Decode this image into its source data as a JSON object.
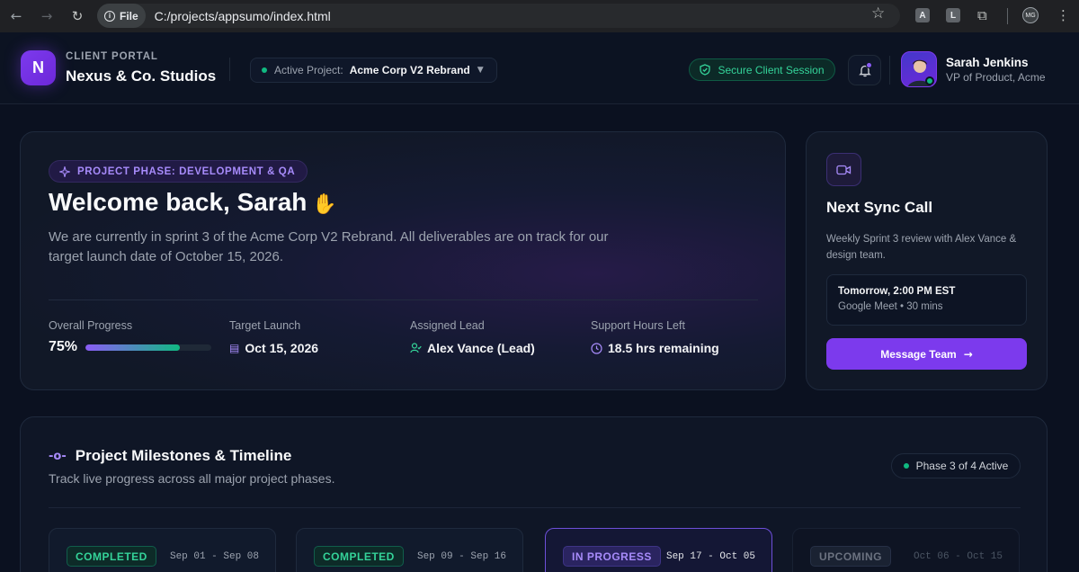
{
  "browser": {
    "file_label": "File",
    "url": "C:/projects/appsumo/index.html",
    "extensions": [
      "A",
      "L"
    ],
    "profile_initials": "MG"
  },
  "header": {
    "logo_letter": "N",
    "eyebrow": "CLIENT PORTAL",
    "brand": "Nexus & Co. Studios",
    "active_project_label": "Active Project:",
    "active_project_value": "Acme Corp V2 Rebrand",
    "secure_session": "Secure Client Session",
    "user": {
      "name": "Sarah Jenkins",
      "role": "VP of Product, Acme"
    }
  },
  "hero": {
    "phase": "PROJECT PHASE: DEVELOPMENT & QA",
    "title": "Welcome back, Sarah",
    "description": "We are currently in sprint 3 of the Acme Corp V2 Rebrand. All deliverables are on track for our target launch date of October 15, 2026.",
    "stats": {
      "progress_label": "Overall Progress",
      "progress_value": "75%",
      "progress_fraction": 0.75,
      "launch_label": "Target Launch",
      "launch_value": "Oct 15, 2026",
      "lead_label": "Assigned Lead",
      "lead_value": "Alex Vance (Lead)",
      "hours_label": "Support Hours Left",
      "hours_value": "18.5 hrs remaining"
    }
  },
  "sync": {
    "title": "Next Sync Call",
    "description": "Weekly Sprint 3 review with Alex Vance & design team.",
    "time": "Tomorrow, 2:00 PM EST",
    "meta": "Google Meet • 30 mins",
    "button": "Message Team"
  },
  "milestones": {
    "title": "Project Milestones & Timeline",
    "subtitle": "Track live progress across all major project phases.",
    "phase_badge": "Phase 3 of 4 Active",
    "cards": [
      {
        "status": "COMPLETED",
        "dates": "Sep 01 - Sep 08"
      },
      {
        "status": "COMPLETED",
        "dates": "Sep 09 - Sep 16"
      },
      {
        "status": "IN PROGRESS",
        "dates": "Sep 17 - Oct 05"
      },
      {
        "status": "UPCOMING",
        "dates": "Oct 06 - Oct 15"
      }
    ]
  },
  "colors": {
    "accent": "#7c3aed",
    "success": "#10b981",
    "background": "#0b1120"
  }
}
